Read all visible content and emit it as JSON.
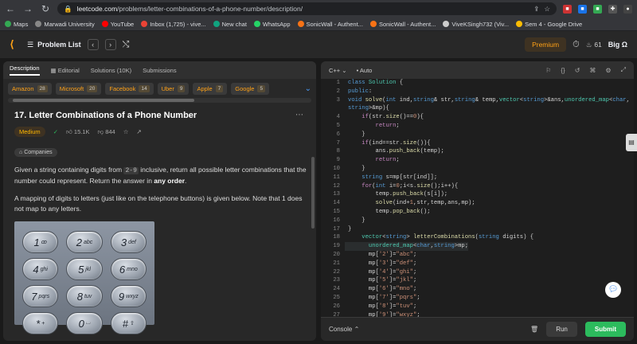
{
  "browser": {
    "url_domain": "leetcode.com",
    "url_path": "/problems/letter-combinations-of-a-phone-number/description/",
    "bookmarks": [
      {
        "label": "Maps",
        "color": "#34a853"
      },
      {
        "label": "Marwadi University",
        "color": "#888888"
      },
      {
        "label": "YouTube",
        "color": "#ff0000"
      },
      {
        "label": "Inbox (1,725) - vive...",
        "color": "#ea4335"
      },
      {
        "label": "New chat",
        "color": "#10a37f"
      },
      {
        "label": "WhatsApp",
        "color": "#25d366"
      },
      {
        "label": "SonicWall - Authent...",
        "color": "#f97316"
      },
      {
        "label": "SonicWall - Authent...",
        "color": "#f97316"
      },
      {
        "label": "ViveKSingh732 (Viv...",
        "color": "#cccccc"
      },
      {
        "label": "Sem 4 - Google Drive",
        "color": "#fbbc04"
      }
    ]
  },
  "header": {
    "problem_list": "Problem List",
    "premium": "Premium",
    "streak": "61",
    "user": "Big Ω"
  },
  "left": {
    "tabs": [
      "Description",
      "Editorial",
      "Solutions (10K)",
      "Submissions"
    ],
    "company_tags": [
      {
        "name": "Amazon",
        "count": "28"
      },
      {
        "name": "Microsoft",
        "count": "20"
      },
      {
        "name": "Facebook",
        "count": "14"
      },
      {
        "name": "Uber",
        "count": "9"
      },
      {
        "name": "Apple",
        "count": "7"
      },
      {
        "name": "Google",
        "count": "5"
      }
    ],
    "title": "17. Letter Combinations of a Phone Number",
    "difficulty": "Medium",
    "likes": "15.1K",
    "dislikes": "844",
    "companies": "Companies",
    "desc1_a": "Given a string containing digits from ",
    "desc1_code": "2-9",
    "desc1_b": " inclusive, return all possible letter combinations that the number could represent. Return the answer in ",
    "desc1_bold": "any order",
    "desc1_c": ".",
    "desc2": "A mapping of digits to letters (just like on the telephone buttons) is given below. Note that 1 does not map to any letters.",
    "keypad": [
      {
        "n": "1",
        "l": "ꝏ"
      },
      {
        "n": "2",
        "l": "abc"
      },
      {
        "n": "3",
        "l": "def"
      },
      {
        "n": "4",
        "l": "ghi"
      },
      {
        "n": "5",
        "l": "jkl"
      },
      {
        "n": "6",
        "l": "mno"
      },
      {
        "n": "7",
        "l": "pqrs"
      },
      {
        "n": "8",
        "l": "tuv"
      },
      {
        "n": "9",
        "l": "wxyz"
      },
      {
        "n": "*",
        "l": "+"
      },
      {
        "n": "0",
        "l": "⌴"
      },
      {
        "n": "#",
        "l": "⇧"
      }
    ]
  },
  "editor": {
    "language": "C++",
    "mode": "Auto",
    "console": "Console",
    "run": "Run",
    "submit": "Submit"
  }
}
